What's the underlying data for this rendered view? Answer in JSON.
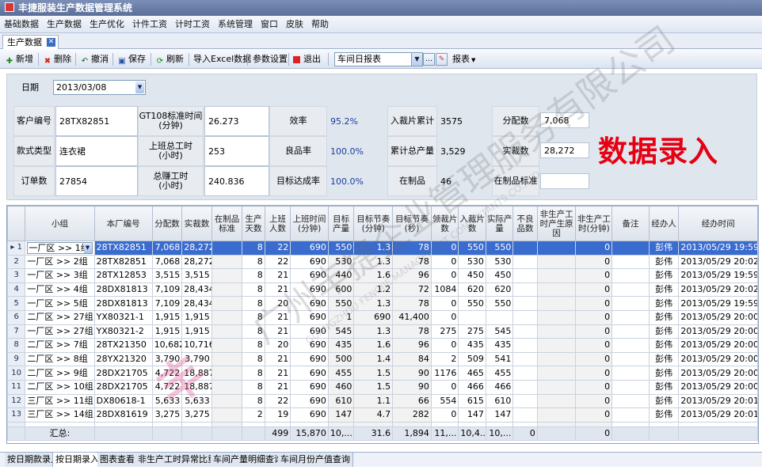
{
  "window": {
    "title": "丰捷服装生产数据管理系统"
  },
  "menu": [
    "基础数据",
    "生产数据",
    "生产优化",
    "计件工资",
    "计时工资",
    "系统管理",
    "窗口",
    "皮肤",
    "帮助"
  ],
  "doc_tab": {
    "label": "生产数据"
  },
  "toolbar": {
    "add": "新增",
    "delete": "删除",
    "undo": "撤消",
    "save": "保存",
    "refresh": "刷新",
    "import": "导入Excel数据",
    "params": "参数设置",
    "exit": "退出",
    "report_select": "车间日报表",
    "report_menu": "报表"
  },
  "form": {
    "date_label": "日期",
    "date_value": "2013/03/08",
    "customer_no_label": "客户编号",
    "customer_no": "28TX82851",
    "style_label": "款式类型",
    "style": "连衣裙",
    "order_label": "订单数",
    "order": "27854",
    "std_time_label": "GT108标准时间\n(分钟)",
    "std_time": "26.273",
    "work_hours_label": "上班总工时\n(小时)",
    "work_hours": "253",
    "earned_hours_label": "总赚工时\n(小时)",
    "earned_hours": "240.836",
    "efficiency_label": "效率",
    "efficiency": "95.2%",
    "yield_label": "良品率",
    "yield": "100.0%",
    "target_rate_label": "目标达成率",
    "target_rate": "100.0%",
    "cut_cum_label": "入裁片累计",
    "cut_cum": "3575",
    "total_output_label": "累计总产量",
    "total_output": "3,529",
    "wip_label": "在制品",
    "wip": "46",
    "alloc_label": "分配数",
    "alloc": "7,068",
    "actual_cut_label": "实裁数",
    "actual_cut": "28,272",
    "wip_std_label": "在制品标准",
    "wip_std": "",
    "big_label": "数据录入"
  },
  "grid": {
    "headers": [
      "",
      "小组",
      "本厂编号",
      "分配数",
      "实裁数",
      "在制品标准",
      "生产天数",
      "上班人数",
      "上班时间(分钟)",
      "目标产量",
      "目标节奏(分钟)",
      "目标节奏(秒)",
      "领裁片数",
      "入裁片数",
      "实际产量",
      "不良品数",
      "非生产工时产生原因",
      "非生产工时(分钟)",
      "备注",
      "经办人",
      "经办时间"
    ],
    "rows": [
      [
        "1",
        "一厂区 >> 1组",
        "28TX82851",
        "7,068",
        "28,272",
        "",
        "8",
        "22",
        "690",
        "550",
        "1.3",
        "78",
        "0",
        "550",
        "550",
        "",
        "",
        "0",
        "",
        "彭伟",
        "2013/05/29 19:59"
      ],
      [
        "2",
        "一厂区 >> 2组",
        "28TX82851",
        "7,068",
        "28,272",
        "",
        "8",
        "22",
        "690",
        "530",
        "1.3",
        "78",
        "0",
        "530",
        "530",
        "",
        "",
        "0",
        "",
        "彭伟",
        "2013/05/29 20:02"
      ],
      [
        "3",
        "一厂区 >> 3组",
        "28TX12853",
        "3,515",
        "3,515",
        "",
        "8",
        "21",
        "690",
        "440",
        "1.6",
        "96",
        "0",
        "450",
        "450",
        "",
        "",
        "0",
        "",
        "彭伟",
        "2013/05/29 19:59"
      ],
      [
        "4",
        "一厂区 >> 4组",
        "28DX81813",
        "7,109",
        "28,434",
        "",
        "8",
        "21",
        "690",
        "600",
        "1.2",
        "72",
        "1084",
        "620",
        "620",
        "",
        "",
        "0",
        "",
        "彭伟",
        "2013/05/29 20:02"
      ],
      [
        "5",
        "一厂区 >> 5组",
        "28DX81813",
        "7,109",
        "28,434",
        "",
        "8",
        "20",
        "690",
        "550",
        "1.3",
        "78",
        "0",
        "550",
        "550",
        "",
        "",
        "0",
        "",
        "彭伟",
        "2013/05/29 19:59"
      ],
      [
        "6",
        "二厂区 >> 27组",
        "YX80321-1",
        "1,915",
        "1,915",
        "",
        "8",
        "21",
        "690",
        "1",
        "690",
        "41,400",
        "0",
        "",
        "",
        "",
        "",
        "0",
        "",
        "彭伟",
        "2013/05/29 20:00"
      ],
      [
        "7",
        "一厂区 >> 27组",
        "YX80321-2",
        "1,915",
        "1,915",
        "",
        "8",
        "21",
        "690",
        "545",
        "1.3",
        "78",
        "275",
        "275",
        "545",
        "",
        "",
        "0",
        "",
        "彭伟",
        "2013/05/29 20:00"
      ],
      [
        "8",
        "二厂区 >> 7组",
        "28TX21350",
        "10,682",
        "10,716",
        "",
        "8",
        "20",
        "690",
        "435",
        "1.6",
        "96",
        "0",
        "435",
        "435",
        "",
        "",
        "0",
        "",
        "彭伟",
        "2013/05/29 20:00"
      ],
      [
        "9",
        "二厂区 >> 8组",
        "28YX21320",
        "3,790",
        "3,790",
        "",
        "8",
        "21",
        "690",
        "500",
        "1.4",
        "84",
        "2",
        "509",
        "541",
        "",
        "",
        "0",
        "",
        "彭伟",
        "2013/05/29 20:00"
      ],
      [
        "10",
        "二厂区 >> 9组",
        "28DX21705",
        "4,722",
        "18,887",
        "",
        "8",
        "21",
        "690",
        "455",
        "1.5",
        "90",
        "1176",
        "465",
        "455",
        "",
        "",
        "0",
        "",
        "彭伟",
        "2013/05/29 20:00"
      ],
      [
        "11",
        "二厂区 >> 10组",
        "28DX21705",
        "4,722",
        "18,887",
        "",
        "8",
        "21",
        "690",
        "460",
        "1.5",
        "90",
        "0",
        "466",
        "466",
        "",
        "",
        "0",
        "",
        "彭伟",
        "2013/05/29 20:00"
      ],
      [
        "12",
        "三厂区 >> 11组",
        "DX80618-1",
        "5,633",
        "5,633",
        "",
        "8",
        "22",
        "690",
        "610",
        "1.1",
        "66",
        "554",
        "615",
        "610",
        "",
        "",
        "0",
        "",
        "彭伟",
        "2013/05/29 20:01"
      ],
      [
        "13",
        "三厂区 >> 14组",
        "28DX81619",
        "3,275",
        "3,275",
        "",
        "2",
        "19",
        "690",
        "147",
        "4.7",
        "282",
        "0",
        "147",
        "147",
        "",
        "",
        "0",
        "",
        "彭伟",
        "2013/05/29 20:01"
      ]
    ],
    "summary": [
      "",
      "汇总:",
      "",
      "",
      "",
      "",
      "",
      "499",
      "15,870",
      "10,...",
      "31.6",
      "1,894",
      "11,...",
      "10,4...",
      "10,...",
      "0",
      "",
      "0",
      "",
      "",
      ""
    ]
  },
  "bottom_tabs": [
    "按日期款录入",
    "按日期录入",
    "图表查看",
    "非生产工时异常比重",
    "车间产量明细查询",
    "车间月份产值查询"
  ],
  "watermark": {
    "company": "广州丰捷企业管理服务有限公司",
    "company_en": "GUANGZHOU FENGJIE MANAGEMENT CONSULTANTS CO.,LTD"
  }
}
